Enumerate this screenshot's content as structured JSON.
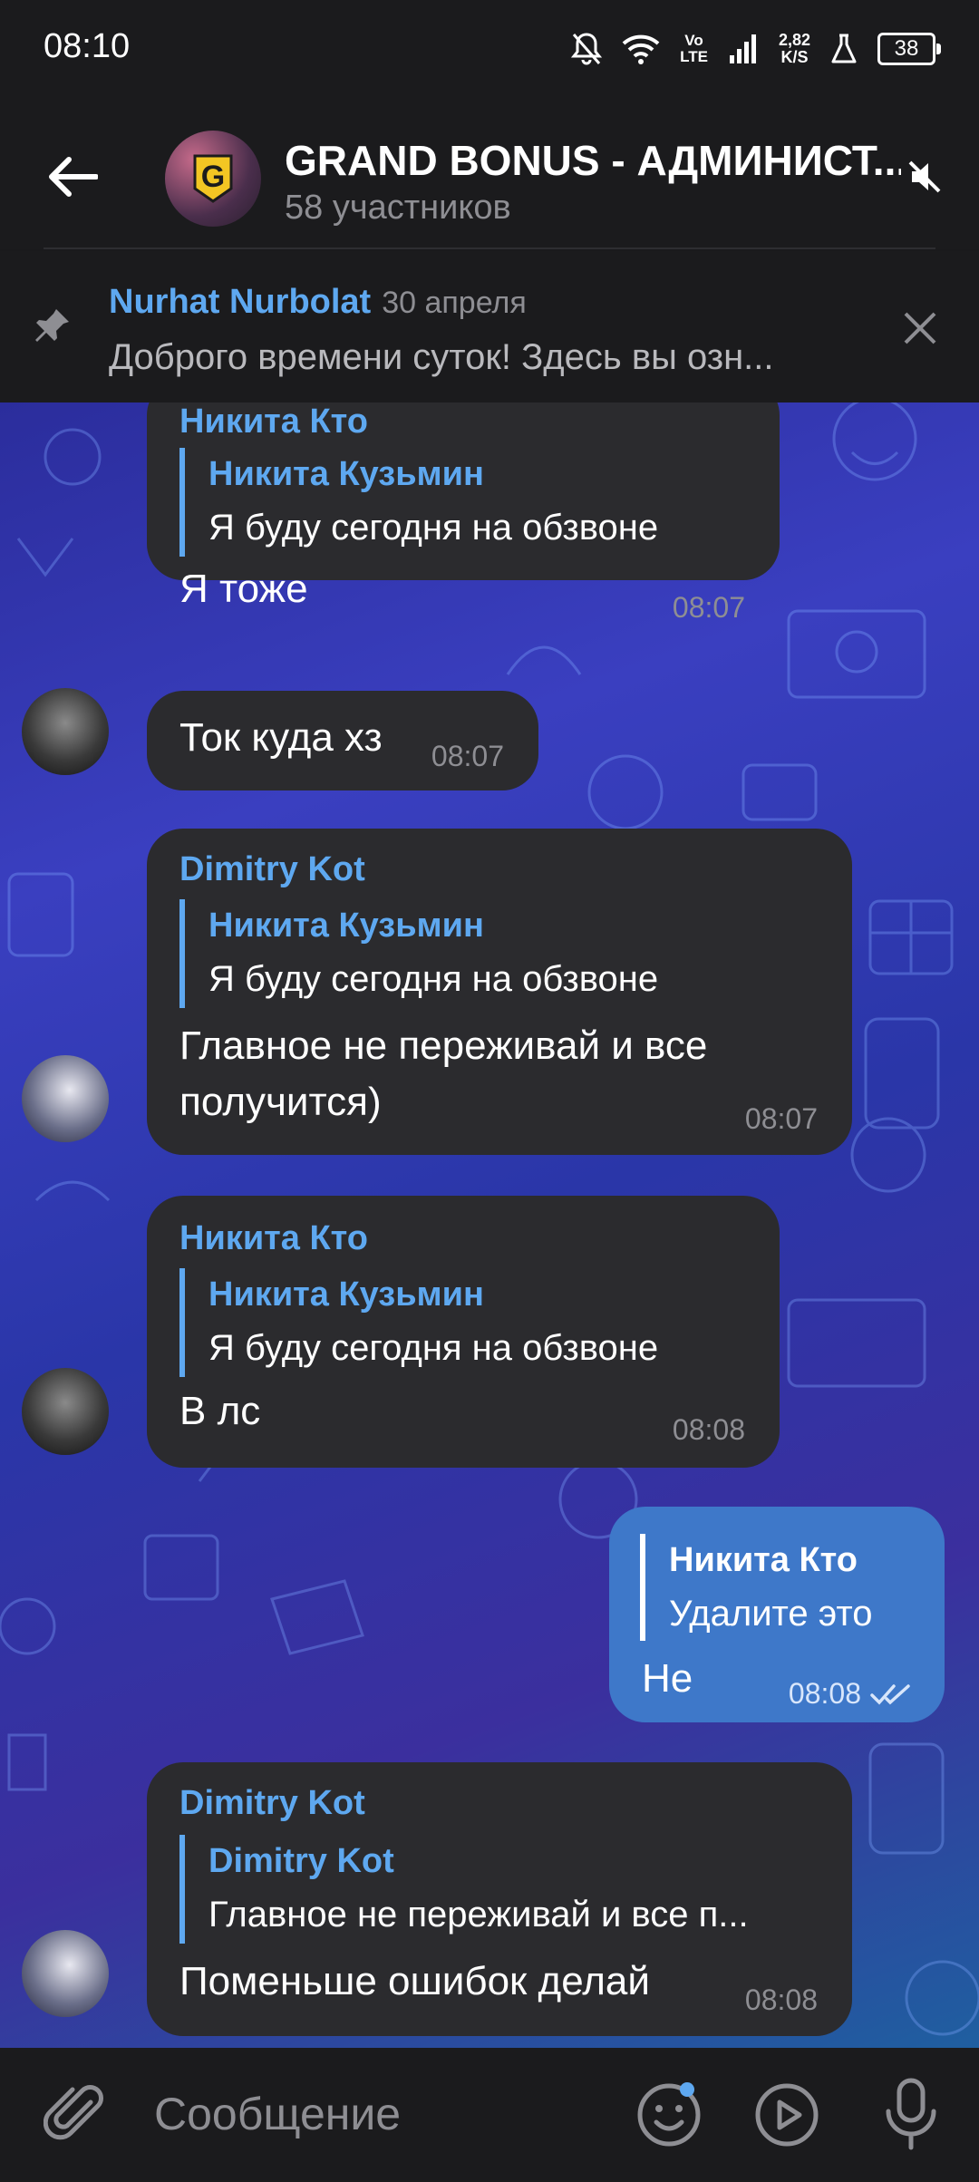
{
  "status_bar": {
    "time": "08:10",
    "lte_top": "Vo",
    "lte_bottom": "LTE",
    "speed_top": "2,82",
    "speed_bottom": "K/S",
    "battery": "38"
  },
  "header": {
    "title": "GRAND BONUS - АДМИНИСТ...",
    "subtitle": "58 участников"
  },
  "pinned": {
    "sender": "Nurhat Nurbolat",
    "date": "30 апреля",
    "text": "Доброго времени суток!  Здесь вы озн..."
  },
  "messages": [
    {
      "sender": "Никита Кто",
      "reply_to": "Никита Кузьмин",
      "reply_text": "Я буду сегодня на обзвоне",
      "text": "Я тоже",
      "time": "08:07"
    },
    {
      "text": "Ток куда хз",
      "time": "08:07"
    },
    {
      "sender": "Dimitry Kot",
      "reply_to": "Никита Кузьмин",
      "reply_text": "Я буду сегодня на обзвоне",
      "text_line1": "Главное не переживай и все",
      "text_line2": "получится)",
      "time": "08:07"
    },
    {
      "sender": "Никита Кто",
      "reply_to": "Никита Кузьмин",
      "reply_text": "Я буду сегодня на обзвоне",
      "text": "В лс",
      "time": "08:08"
    },
    {
      "reply_to": "Никита Кто",
      "reply_text": "Удалите это",
      "text": "Не",
      "time": "08:08"
    },
    {
      "sender": "Dimitry Kot",
      "reply_to": "Dimitry Kot",
      "reply_text": "Главное не переживай и все п...",
      "text": "Поменьше ошибок делай",
      "time": "08:08"
    }
  ],
  "input": {
    "placeholder": "Сообщение"
  },
  "icons": [
    "back-arrow-icon",
    "mute-icon",
    "pin-icon",
    "close-icon",
    "attach-icon",
    "emoji-icon",
    "gif-icon",
    "mic-icon",
    "double-check-icon"
  ]
}
